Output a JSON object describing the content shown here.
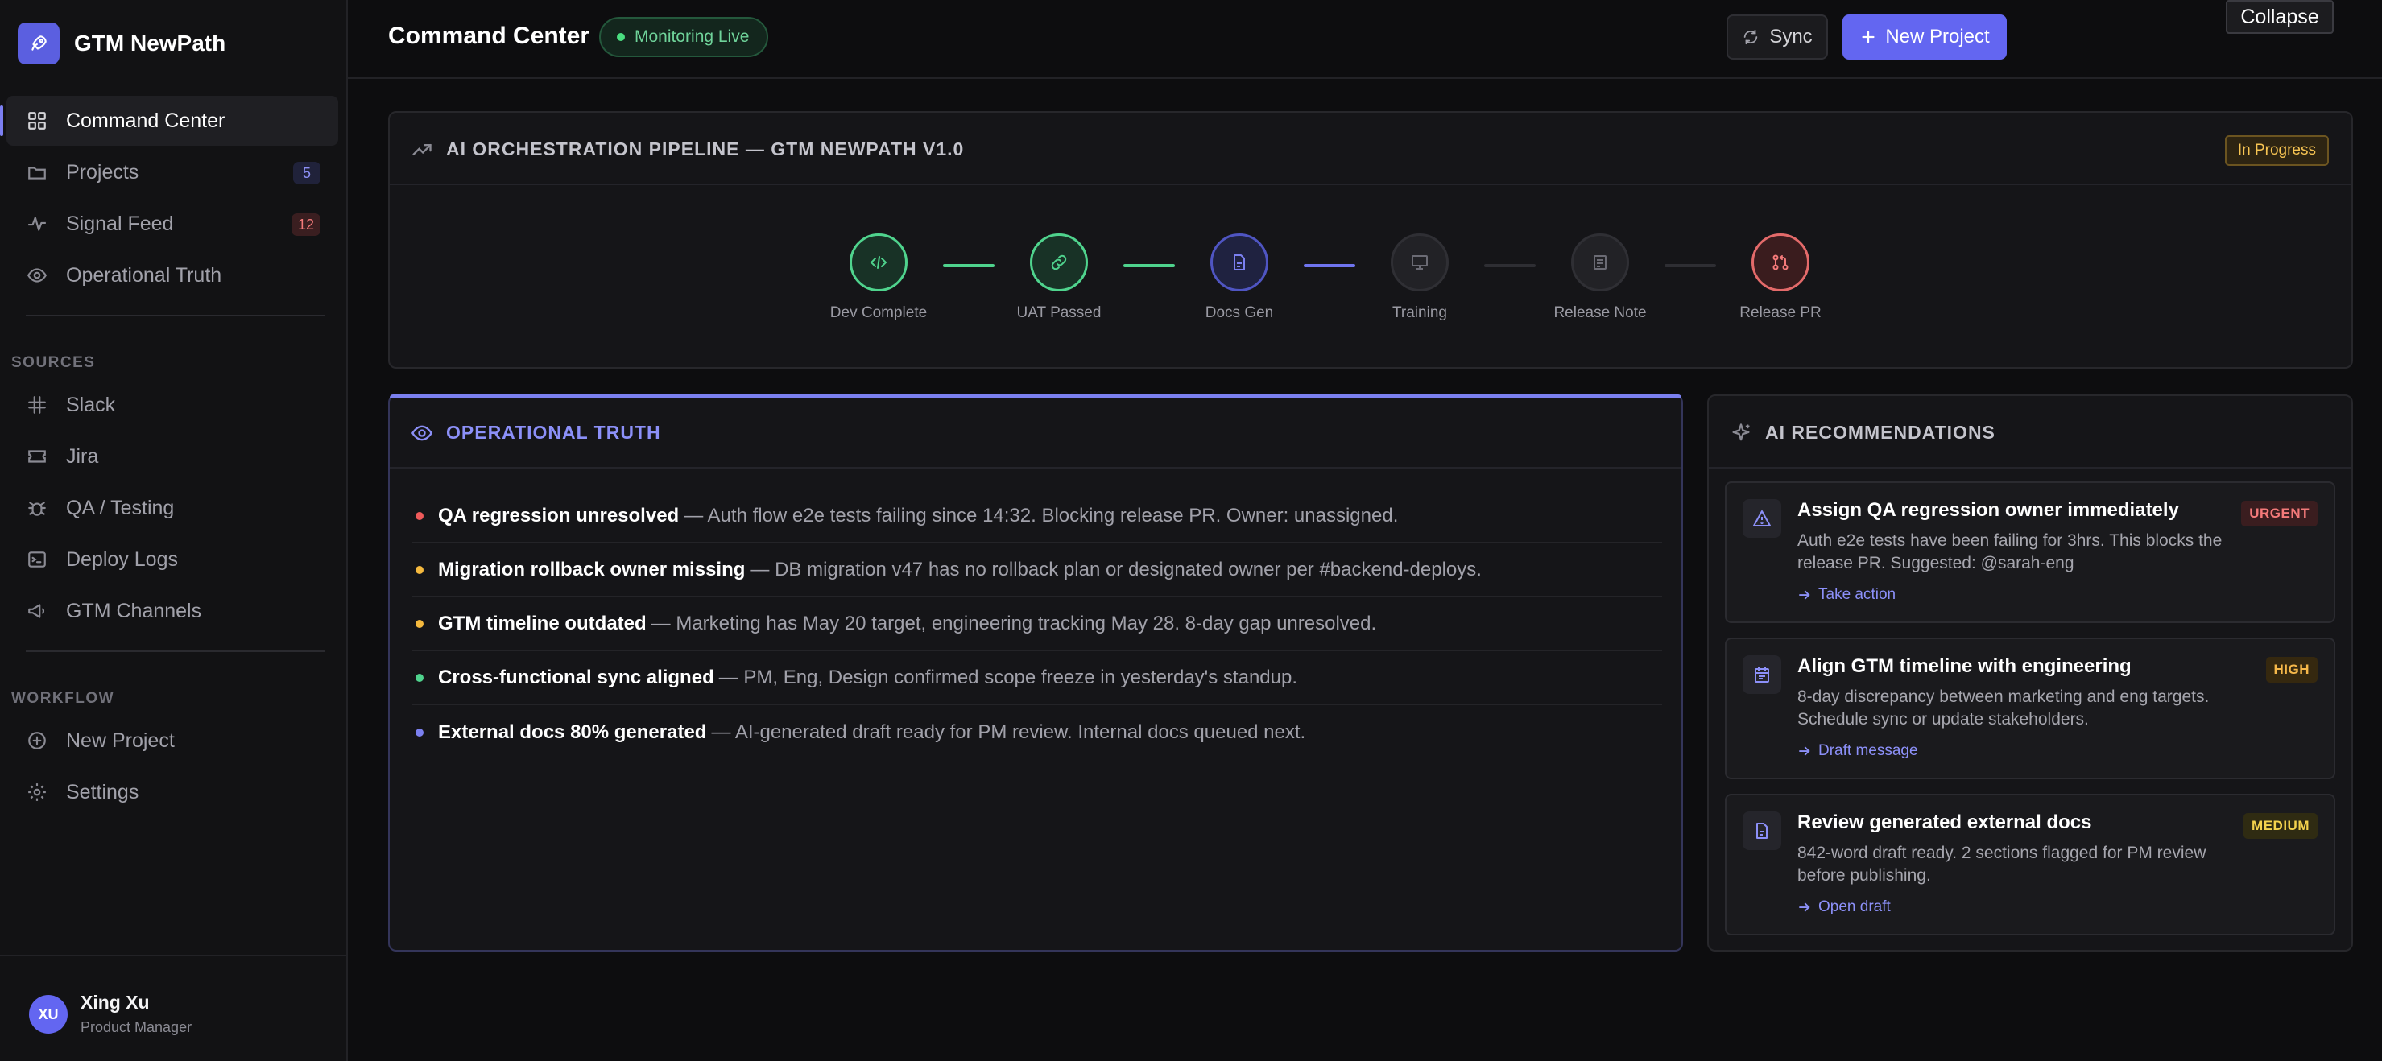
{
  "brand": {
    "name": "GTM NewPath"
  },
  "nav": {
    "main": [
      {
        "label": "Command Center",
        "icon": "grid-icon",
        "active": true
      },
      {
        "label": "Projects",
        "icon": "folder-icon",
        "badge": "5"
      },
      {
        "label": "Signal Feed",
        "icon": "activity-icon",
        "badge": "12"
      },
      {
        "label": "Operational Truth",
        "icon": "eye-icon"
      }
    ],
    "sources_label": "SOURCES",
    "sources": [
      {
        "label": "Slack",
        "icon": "slack-icon"
      },
      {
        "label": "Jira",
        "icon": "ticket-icon"
      },
      {
        "label": "QA / Testing",
        "icon": "bug-icon"
      },
      {
        "label": "Deploy Logs",
        "icon": "terminal-icon"
      },
      {
        "label": "GTM Channels",
        "icon": "megaphone-icon"
      }
    ],
    "workflow_label": "WORKFLOW",
    "workflow": [
      {
        "label": "New Project",
        "icon": "plus-circle-icon"
      },
      {
        "label": "Settings",
        "icon": "gear-icon"
      }
    ]
  },
  "user": {
    "initials": "XU",
    "name": "Xing Xu",
    "role": "Product Manager"
  },
  "header": {
    "title": "Command Center",
    "status": "Monitoring Live",
    "sync_label": "Sync",
    "new_project_label": "New Project",
    "tooltip": "Collapse"
  },
  "pipeline": {
    "title": "AI Orchestration Pipeline — GTM NewPath v1.0",
    "status": "In Progress",
    "stages": [
      {
        "label": "Dev Complete",
        "state": "done"
      },
      {
        "label": "UAT Passed",
        "state": "done"
      },
      {
        "label": "Docs Gen",
        "state": "active"
      },
      {
        "label": "Training",
        "state": "pending"
      },
      {
        "label": "Release Note",
        "state": "pending"
      },
      {
        "label": "Release PR",
        "state": "blocked"
      }
    ]
  },
  "truth": {
    "title": "Operational Truth",
    "items": [
      {
        "strong": "QA regression unresolved",
        "text": "— Auth flow e2e tests failing since 14:32. Blocking release PR. Owner: unassigned.",
        "color": "#ef5a5a"
      },
      {
        "strong": "Migration rollback owner missing",
        "text": "— DB migration v47 has no rollback plan or designated owner per #backend-deploys.",
        "color": "#f5b93e"
      },
      {
        "strong": "GTM timeline outdated",
        "text": "— Marketing has May 20 target, engineering tracking May 28. 8-day gap unresolved.",
        "color": "#f5b93e"
      },
      {
        "strong": "Cross-functional sync aligned",
        "text": "— PM, Eng, Design confirmed scope freeze in yesterday's standup.",
        "color": "#4fd38d"
      },
      {
        "strong": "External docs 80% generated",
        "text": "— AI-generated draft ready for PM review. Internal docs queued next.",
        "color": "#7b80f0"
      }
    ]
  },
  "recommendations": {
    "title": "AI Recommendations",
    "items": [
      {
        "title": "Assign QA regression owner immediately",
        "desc": "Auth e2e tests have been failing for 3hrs. This blocks the release PR. Suggested: @sarah-eng",
        "action": "Take action",
        "priority": "URGENT",
        "icon": "warning-icon"
      },
      {
        "title": "Align GTM timeline with engineering",
        "desc": "8-day discrepancy between marketing and eng targets. Schedule sync or update stakeholders.",
        "action": "Draft message",
        "priority": "HIGH",
        "icon": "calendar-icon"
      },
      {
        "title": "Review generated external docs",
        "desc": "842-word draft ready. 2 sections flagged for PM review before publishing.",
        "action": "Open draft",
        "priority": "MEDIUM",
        "icon": "document-icon"
      }
    ]
  }
}
